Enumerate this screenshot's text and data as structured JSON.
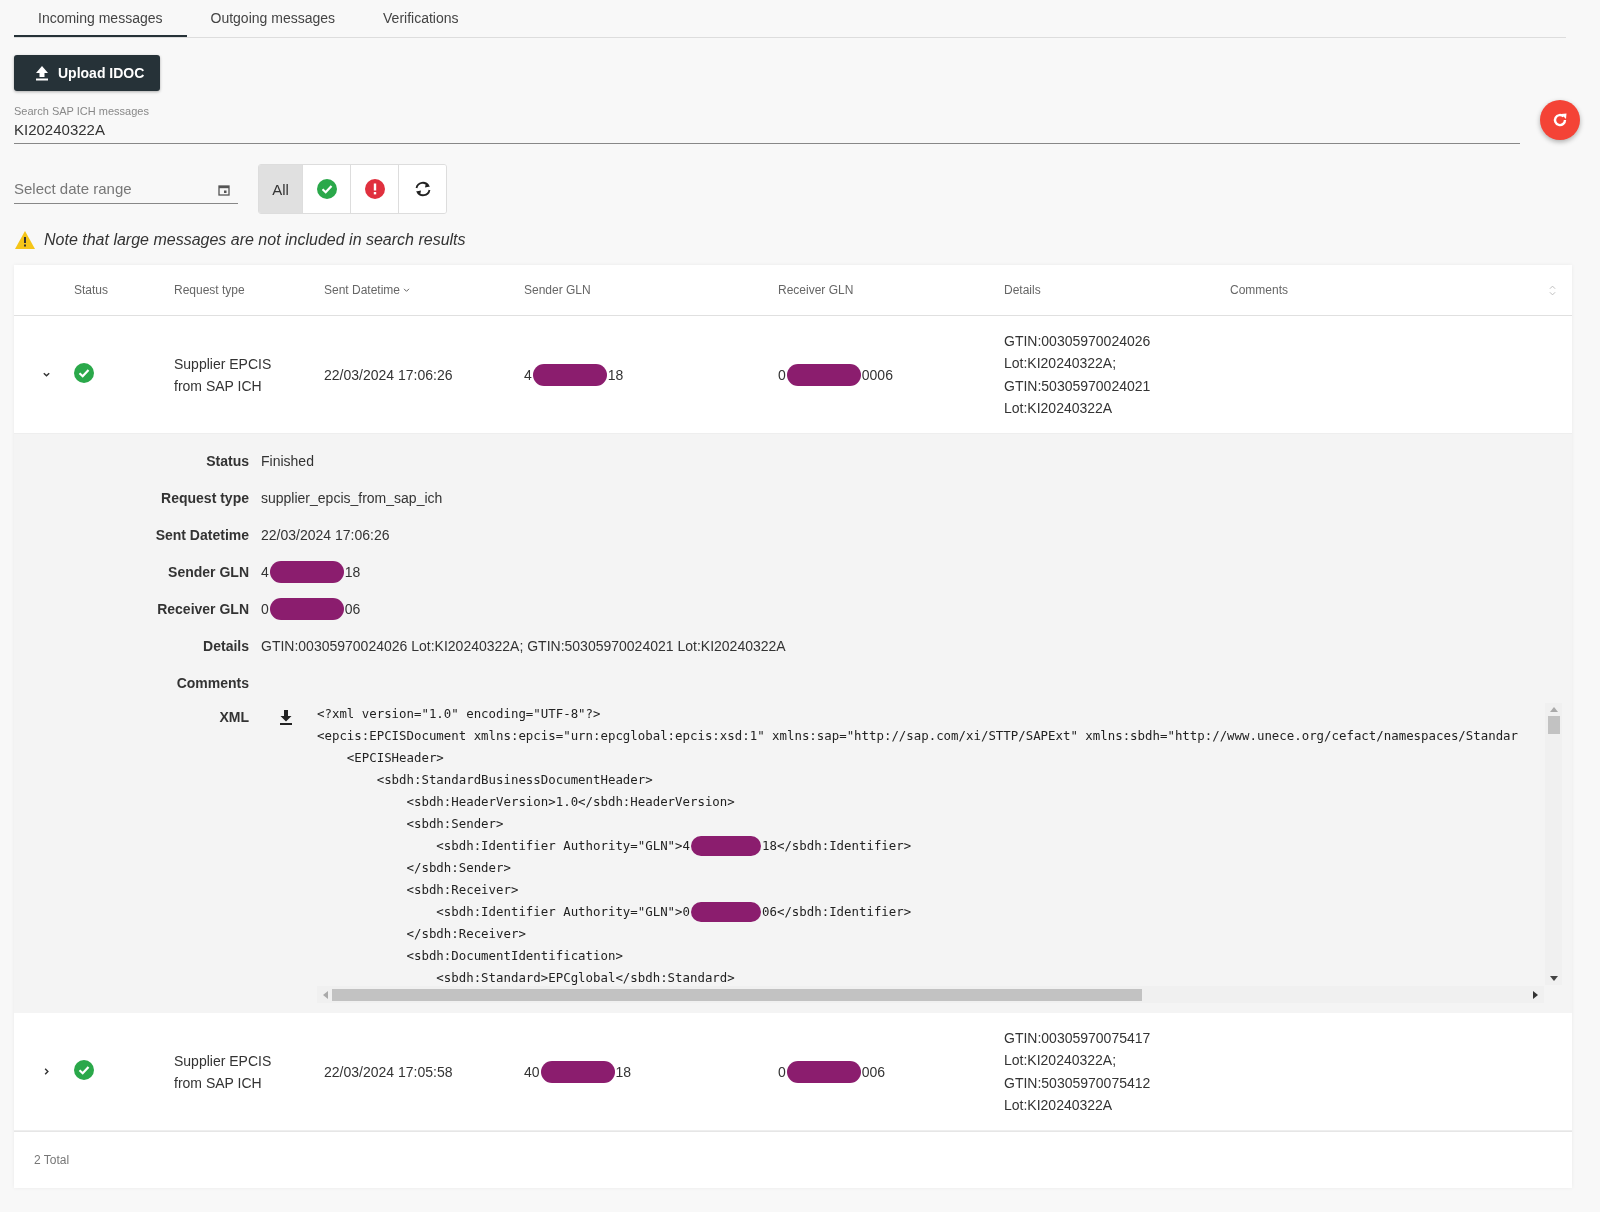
{
  "tabs": [
    {
      "label": "Incoming messages",
      "selected": true
    },
    {
      "label": "Outgoing messages",
      "selected": false
    },
    {
      "label": "Verifications",
      "selected": false
    }
  ],
  "upload_button": {
    "label": "Upload IDOC"
  },
  "search": {
    "label": "Search SAP ICH messages",
    "value": "KI20240322A"
  },
  "date_range": {
    "placeholder": "Select date range"
  },
  "filters": [
    {
      "kind": "all",
      "label": "All",
      "selected": true
    },
    {
      "kind": "success",
      "selected": false
    },
    {
      "kind": "error",
      "selected": false
    },
    {
      "kind": "pending",
      "selected": false
    }
  ],
  "note": "Note that large messages are not included in search results",
  "table": {
    "columns": [
      {
        "label": "Status",
        "sorted": false
      },
      {
        "label": "Request type",
        "sorted": false
      },
      {
        "label": "Sent Datetime",
        "sorted": true
      },
      {
        "label": "Sender GLN",
        "sorted": false
      },
      {
        "label": "Receiver GLN",
        "sorted": false
      },
      {
        "label": "Details",
        "sorted": false
      },
      {
        "label": "Comments",
        "sorted": false
      }
    ],
    "rows": [
      {
        "expanded": true,
        "kind": "success",
        "request_type": "Supplier EPCIS from SAP ICH",
        "sent": "22/03/2024 17:06:26",
        "sender": [
          "4",
          "18"
        ],
        "receiver": [
          "0",
          "0006"
        ],
        "details": [
          "GTIN:00305970024026",
          "Lot:KI20240322A;",
          "GTIN:50305970024021",
          "Lot:KI20240322A"
        ],
        "detail": {
          "fields": [
            {
              "label": "Status",
              "parts": [
                "Finished"
              ]
            },
            {
              "label": "Request type",
              "parts": [
                "supplier_epcis_from_sap_ich"
              ]
            },
            {
              "label": "Sent Datetime",
              "parts": [
                "22/03/2024 17:06:26"
              ]
            },
            {
              "label": "Sender GLN",
              "parts": [
                "4",
                "18"
              ]
            },
            {
              "label": "Receiver GLN",
              "parts": [
                "0",
                "06"
              ]
            },
            {
              "label": "Details",
              "parts": [
                "GTIN:00305970024026 Lot:KI20240322A; GTIN:50305970024021 Lot:KI20240322A"
              ]
            },
            {
              "label": "Comments"
            }
          ],
          "xml_label": "XML",
          "xml_lines": [
            {
              "parts": [
                "<?xml version=\"1.0\" encoding=\"UTF-8\"?>"
              ]
            },
            {
              "parts": [
                "<epcis:EPCISDocument xmlns:epcis=\"urn:epcglobal:epcis:xsd:1\" xmlns:sap=\"http://sap.com/xi/STTP/SAPExt\" xmlns:sbdh=\"http://www.unece.org/cefact/namespaces/Standar"
              ]
            },
            {
              "parts": [
                "    <EPCISHeader>"
              ]
            },
            {
              "parts": [
                "        <sbdh:StandardBusinessDocumentHeader>"
              ]
            },
            {
              "parts": [
                "            <sbdh:HeaderVersion>1.0</sbdh:HeaderVersion>"
              ]
            },
            {
              "parts": [
                "            <sbdh:Sender>"
              ]
            },
            {
              "parts": [
                "                <sbdh:Identifier Authority=\"GLN\">4",
                "18</sbdh:Identifier>"
              ]
            },
            {
              "parts": [
                "            </sbdh:Sender>"
              ]
            },
            {
              "parts": [
                "            <sbdh:Receiver>"
              ]
            },
            {
              "parts": [
                "                <sbdh:Identifier Authority=\"GLN\">0",
                "06</sbdh:Identifier>"
              ]
            },
            {
              "parts": [
                "            </sbdh:Receiver>"
              ]
            },
            {
              "parts": [
                "            <sbdh:DocumentIdentification>"
              ]
            },
            {
              "parts": [
                "                <sbdh:Standard>EPCglobal</sbdh:Standard>"
              ]
            }
          ]
        }
      },
      {
        "expanded": false,
        "kind": "success",
        "request_type": "Supplier EPCIS from SAP ICH",
        "sent": "22/03/2024 17:05:58",
        "sender": [
          "40",
          "18"
        ],
        "receiver": [
          "0",
          "006"
        ],
        "details": [
          "GTIN:00305970075417",
          "Lot:KI20240322A;",
          "GTIN:50305970075412",
          "Lot:KI20240322A"
        ]
      }
    ],
    "total": "2 Total"
  }
}
